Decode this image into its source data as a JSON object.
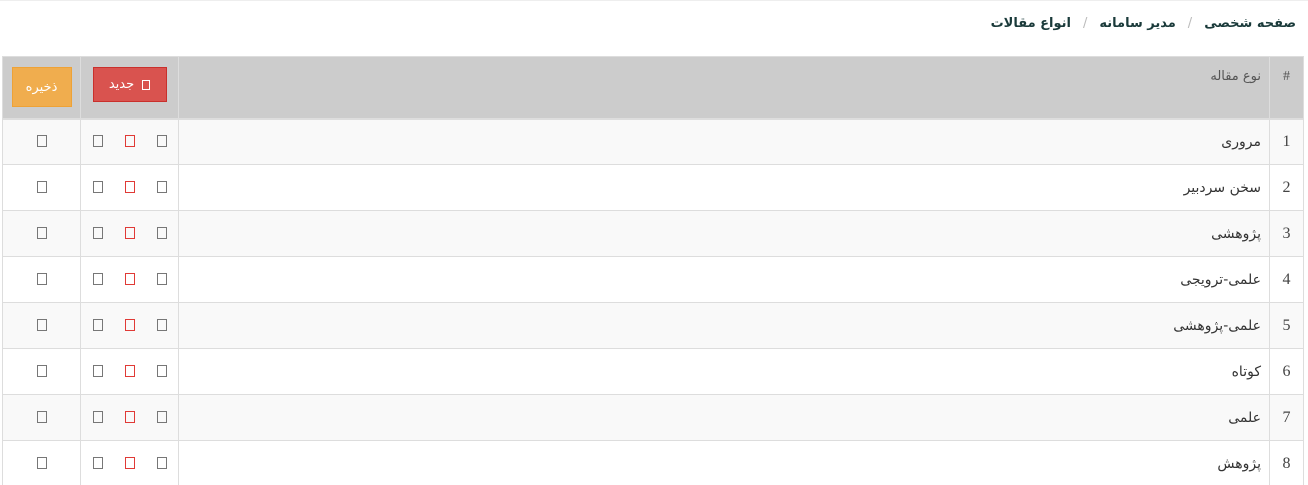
{
  "breadcrumb": {
    "home": "صفحه شخصی",
    "admin": "مدیر سامانه",
    "current": "انواع مقالات",
    "separator": "/"
  },
  "table": {
    "headers": {
      "number": "#",
      "name": "نوع مقاله"
    },
    "new_button": {
      "label": "جدید",
      "icon": "new-icon",
      "color": "#d9534f"
    },
    "save_button": {
      "label": "ذخیره",
      "color": "#f0ad4e"
    },
    "rows": [
      {
        "number": "1",
        "name": "مروری"
      },
      {
        "number": "2",
        "name": "سخن سردبیر"
      },
      {
        "number": "3",
        "name": "پژوهشی"
      },
      {
        "number": "4",
        "name": "علمی-ترویجی"
      },
      {
        "number": "5",
        "name": "علمی-پژوهشی"
      },
      {
        "number": "6",
        "name": "کوتاه"
      },
      {
        "number": "7",
        "name": "علمی"
      },
      {
        "number": "8",
        "name": "پژوهش"
      }
    ],
    "row_icons": [
      "edit-icon",
      "delete-icon",
      "view-icon",
      "select-checkbox-icon"
    ]
  },
  "colors": {
    "header_bg": "#cccccc",
    "striped_row_bg": "#f9f9f9",
    "delete_icon": "#e03a36"
  }
}
